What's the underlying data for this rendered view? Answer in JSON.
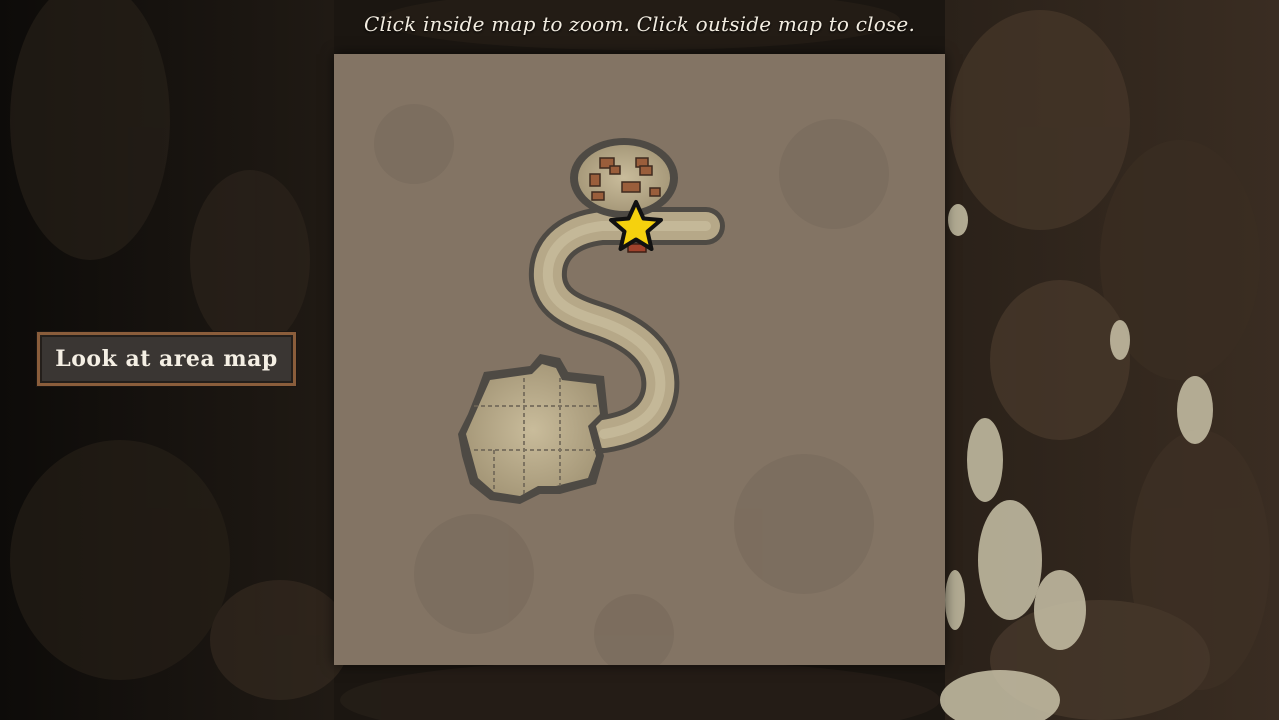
{
  "screen": {
    "instruction": "Click inside map to zoom. Click outside map to close."
  },
  "map": {
    "background_color": "#837464",
    "floor_color": "#b7a98a",
    "wall_color": "#4e4a44",
    "marker_icon": "star-icon",
    "marker_color": "#f5d10e"
  },
  "side_button": {
    "label": "Look at area map"
  }
}
